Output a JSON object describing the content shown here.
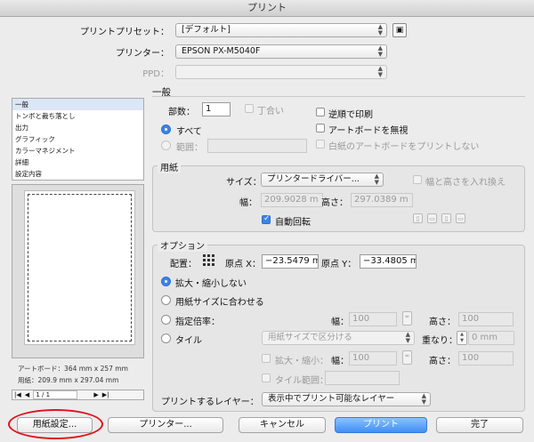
{
  "window": {
    "title": "プリント"
  },
  "top": {
    "preset_label": "プリントプリセット：",
    "preset_value": "[デフォルト]",
    "printer_label": "プリンター：",
    "printer_value": "EPSON PX-M5040F",
    "ppd_label": "PPD：",
    "ppd_value": ""
  },
  "sidebar": {
    "items": [
      {
        "label": "一般"
      },
      {
        "label": "トンボと裁ち落とし"
      },
      {
        "label": "出力"
      },
      {
        "label": "グラフィック"
      },
      {
        "label": "カラーマネジメント"
      },
      {
        "label": "詳細"
      },
      {
        "label": "設定内容"
      }
    ],
    "artboard_info": "アートボード：364 mm x 257 mm",
    "paper_info": "用紙：209.9 mm x 297.04 mm",
    "page_nav": "1 / 1"
  },
  "general": {
    "title": "一般",
    "copies_label": "部数：",
    "copies_value": "1",
    "collate_label": "丁合い",
    "reverse_label": "逆順で印刷",
    "all_label": "すべて",
    "ignore_artboards_label": "アートボードを無視",
    "range_label": "範囲：",
    "range_value": "",
    "skip_blank_label": "白紙のアートボードをプリントしない"
  },
  "paper": {
    "title": "用紙",
    "size_label": "サイズ：",
    "size_value": "プリンタードライバー...",
    "swap_label": "幅と高さを入れ換え",
    "width_label": "幅：",
    "width_value": "209.9028 m",
    "height_label": "高さ：",
    "height_value": "297.0389 m",
    "auto_rotate_label": "自動回転"
  },
  "options": {
    "title": "オプション",
    "placement_label": "配置：",
    "origin_x_label": "原点 X：",
    "origin_x_value": "−23.5479 m",
    "origin_y_label": "原点 Y：",
    "origin_y_value": "−33.4805 m",
    "no_scale_label": "拡大・縮小しない",
    "fit_label": "用紙サイズに合わせる",
    "custom_label": "指定倍率：",
    "width_label": "幅：",
    "width_value": "100",
    "height_label": "高さ：",
    "height_value": "100",
    "tile_label": "タイル",
    "tile_select": "用紙サイズで区分ける",
    "overlap_label": "重なり：",
    "overlap_value": "0 mm",
    "tile_scale_label": "拡大・縮小：",
    "tile_width_label": "幅：",
    "tile_width_value": "100",
    "tile_height_label": "高さ：",
    "tile_height_value": "100",
    "tile_range_label": "タイル範囲：",
    "tile_range_value": "",
    "layers_label": "プリントするレイヤー：",
    "layers_value": "表示中でプリント可能なレイヤー"
  },
  "buttons": {
    "page_setup": "用紙設定...",
    "printer": "プリンター...",
    "cancel": "キャンセル",
    "print": "プリント",
    "done": "完了"
  },
  "colors": {
    "accent": "#3d84e8",
    "highlight_circle": "#e0121d"
  }
}
